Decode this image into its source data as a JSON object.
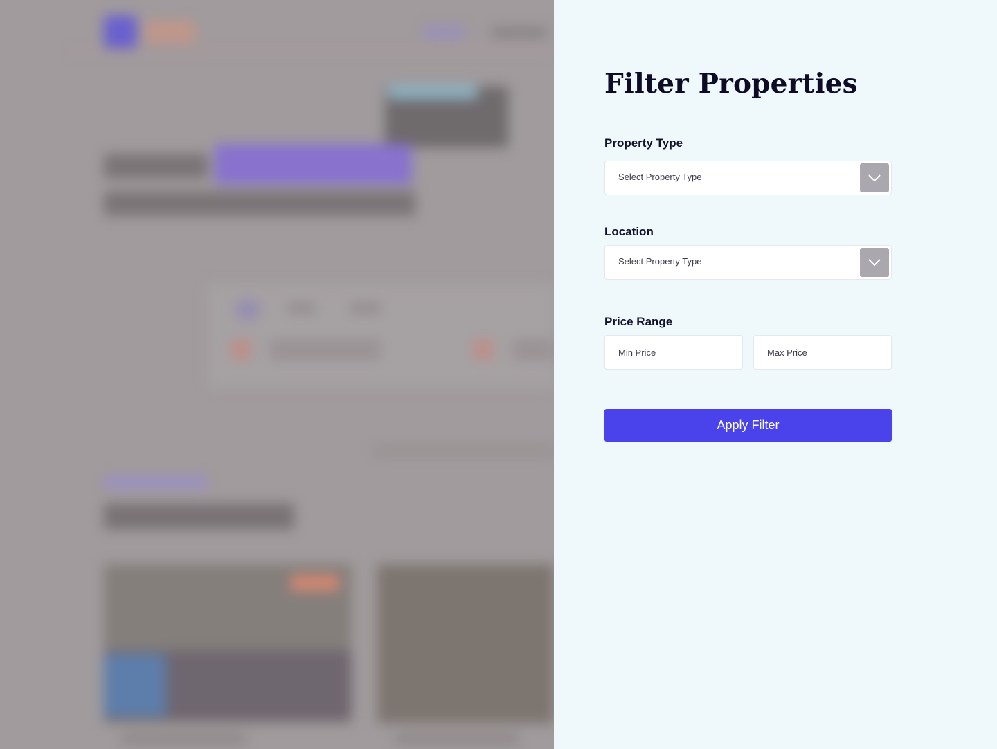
{
  "panel": {
    "title": "Filter Properties",
    "property_type": {
      "label": "Property Type",
      "selected": "Select Property Type",
      "arrow_icon": "chevron-down-icon"
    },
    "location": {
      "label": "Location",
      "selected": "Select Property Type",
      "arrow_icon": "chevron-down-icon"
    },
    "price_range": {
      "label": "Price Range",
      "min_placeholder": "Min Price",
      "max_placeholder": "Max Price"
    },
    "apply_label": "Apply Filter"
  },
  "colors": {
    "panel_bg": "#eff8fb",
    "accent": "#4a43ec",
    "arrow_bg": "#aaa7af",
    "backdrop": "#a59fa1"
  }
}
